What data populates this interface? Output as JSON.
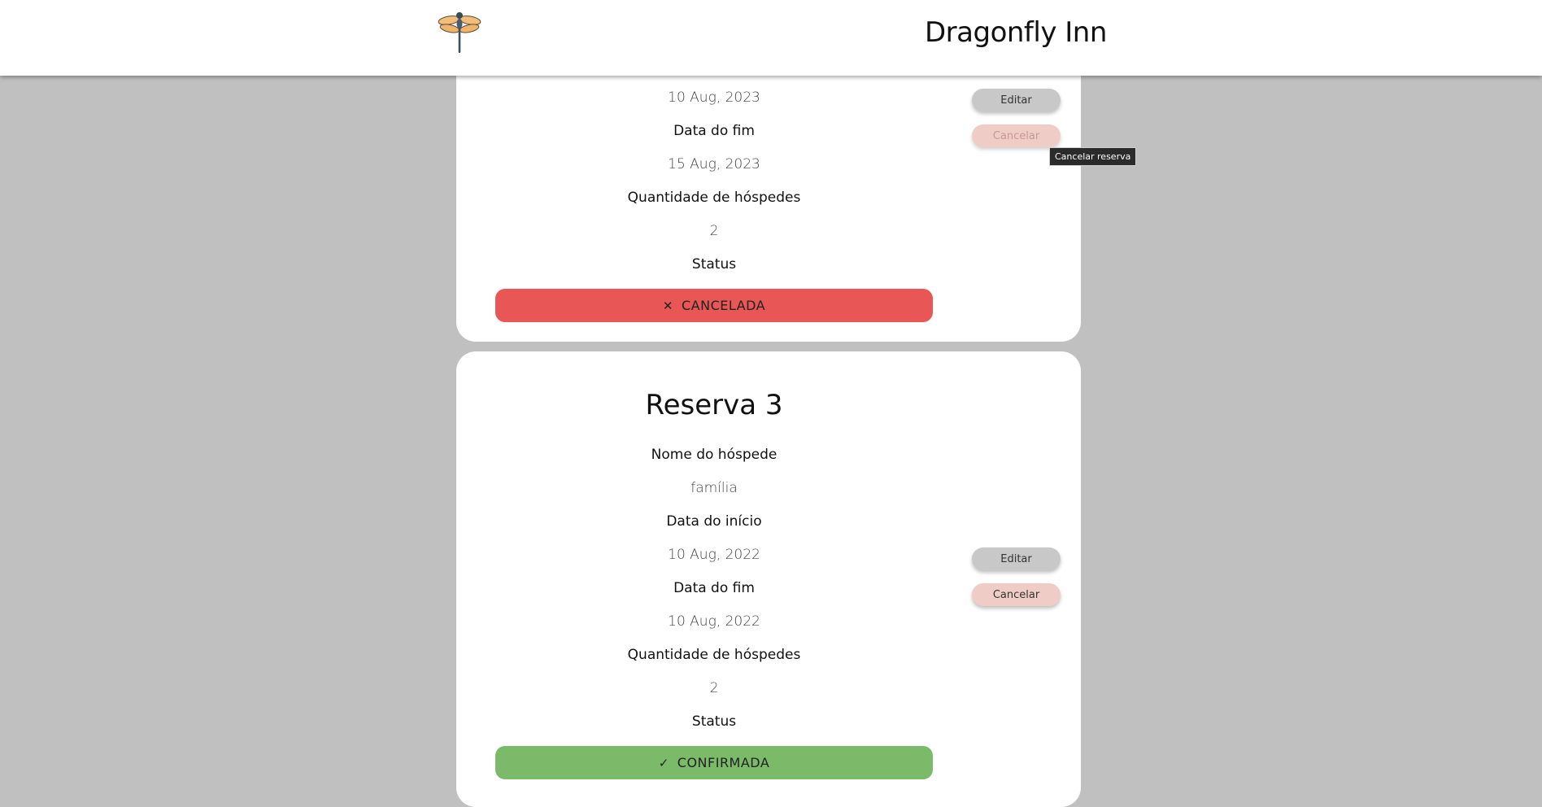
{
  "header": {
    "logo_icon": "dragonfly-icon",
    "title": "Dragonfly Inn"
  },
  "reservations": [
    {
      "start_value": "10 Aug, 2023",
      "end_label": "Data do fim",
      "end_value": "15 Aug, 2023",
      "guests_label": "Quantidade de hóspedes",
      "guests_value": "2",
      "status_label": "Status",
      "status_value": "CANCELADA",
      "status_icon": "close-icon",
      "status_color": "#e85656",
      "edit_label": "Editar",
      "cancel_label": "Cancelar"
    },
    {
      "title": "Reserva 3",
      "name_label": "Nome do hóspede",
      "name_value": "família",
      "start_label": "Data do início",
      "start_value": "10 Aug, 2022",
      "end_label": "Data do fim",
      "end_value": "10 Aug, 2022",
      "guests_label": "Quantidade de hóspedes",
      "guests_value": "2",
      "status_label": "Status",
      "status_value": "CONFIRMADA",
      "status_icon": "check-icon",
      "status_color": "#7aba69",
      "edit_label": "Editar",
      "cancel_label": "Cancelar"
    }
  ],
  "tooltip": {
    "text": "Cancelar reserva"
  },
  "colors": {
    "background": "#c0c0c0",
    "card": "#ffffff",
    "edit_button": "#c8c8c8",
    "cancel_button": "#efcdc6"
  }
}
